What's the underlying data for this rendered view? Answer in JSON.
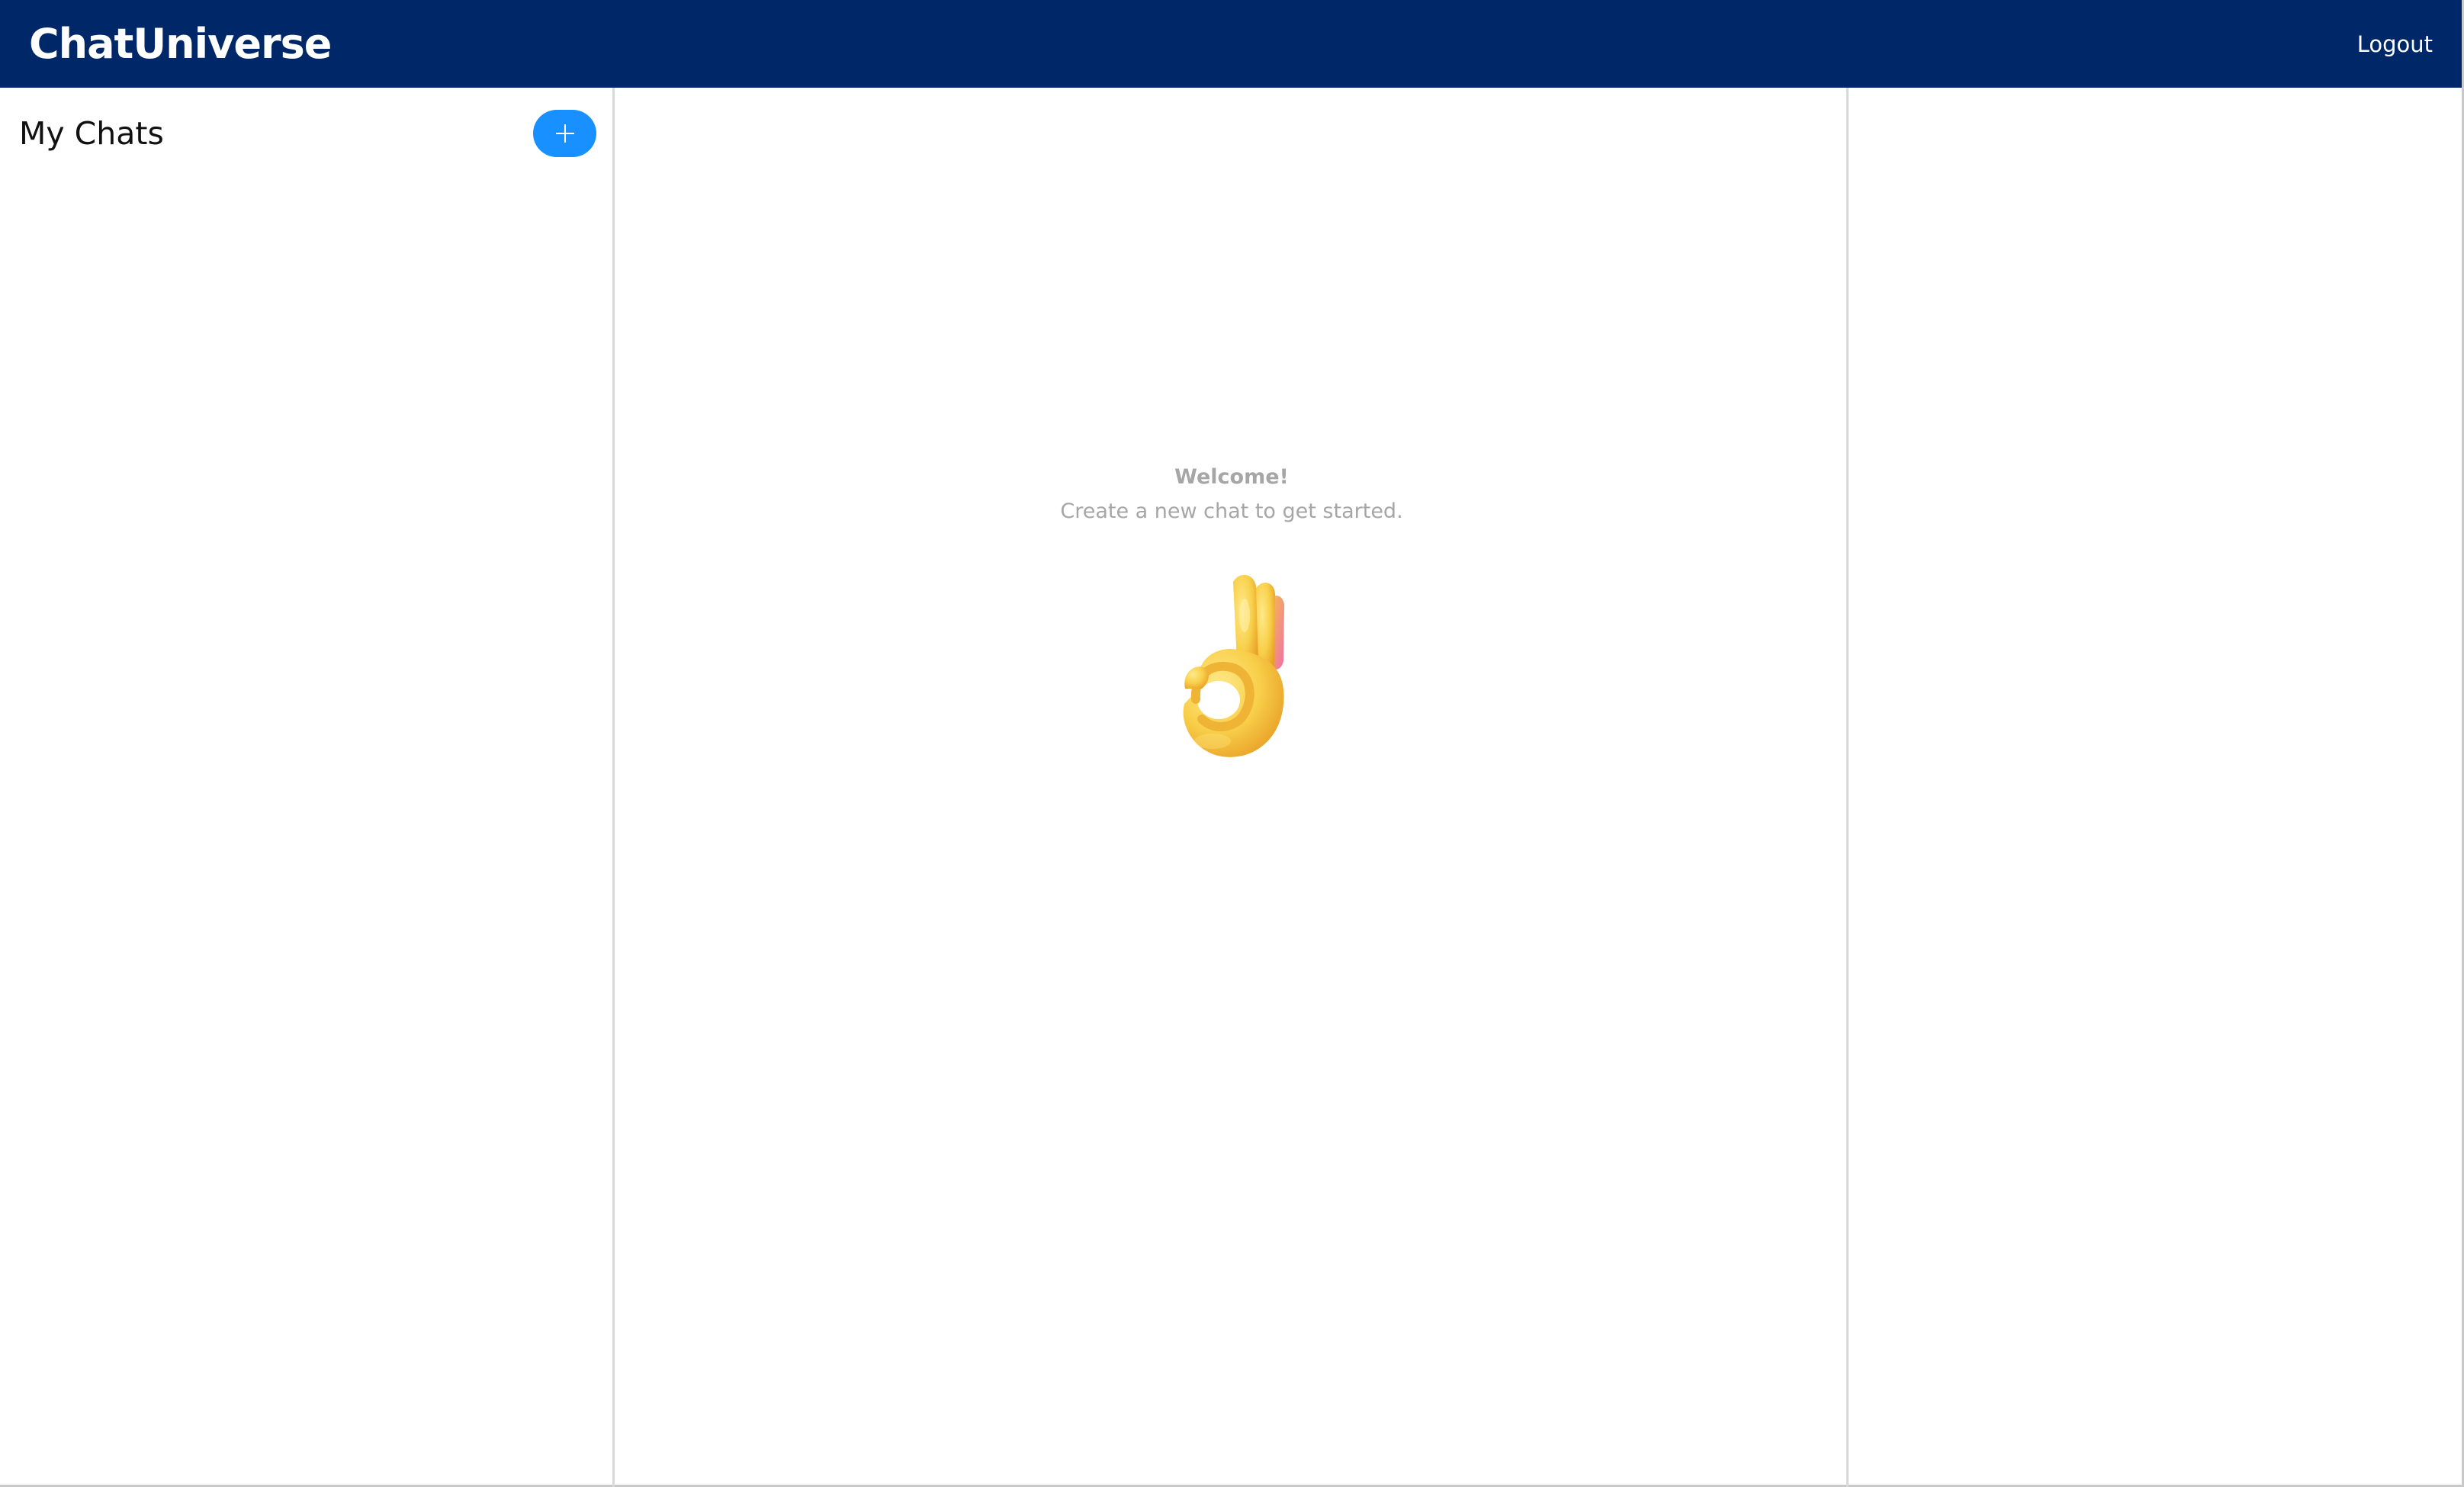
{
  "header": {
    "brand": "ChatUniverse",
    "logout_label": "Logout"
  },
  "sidebar": {
    "title": "My Chats",
    "new_chat_icon": "plus-icon"
  },
  "main": {
    "welcome_title": "Welcome!",
    "welcome_subtitle": "Create a new chat to get started.",
    "illustration": "ok-hand-icon"
  },
  "colors": {
    "header_bg": "#002868",
    "accent": "#1890ff",
    "muted_text": "#a6a6a6",
    "divider": "#d9d9d9"
  }
}
